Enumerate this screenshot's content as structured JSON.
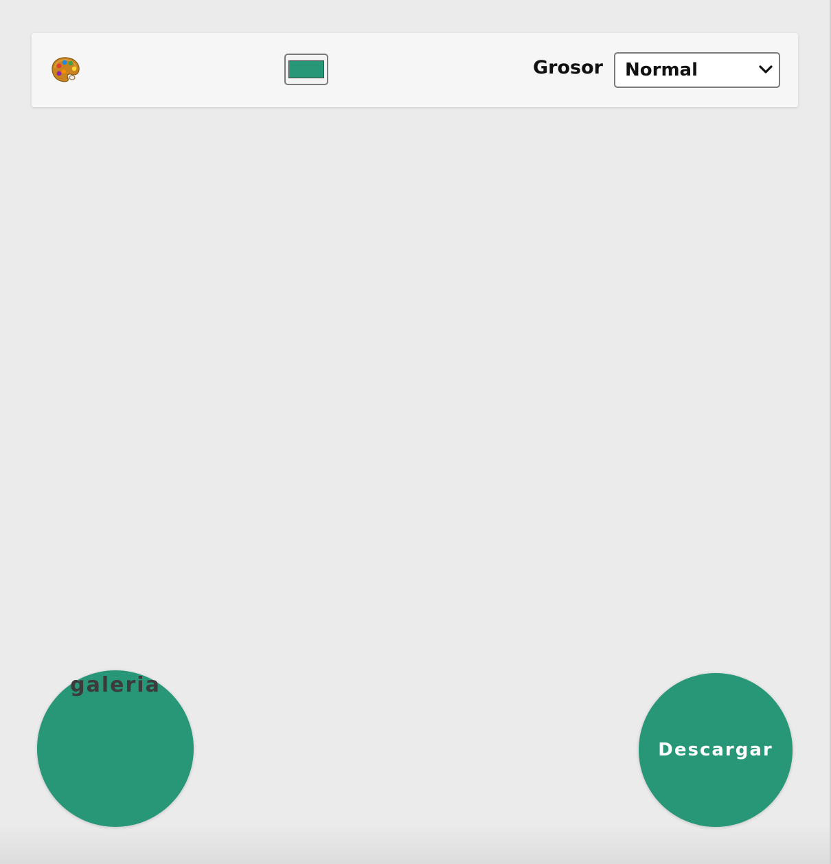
{
  "toolbar": {
    "palette_icon": "artist-palette-icon",
    "color_value": "#279777",
    "grosor_label": "Grosor",
    "grosor_selected": "Normal",
    "chevron_icon": "chevron-down-icon"
  },
  "buttons": {
    "galeria_label": "galeria",
    "descargar_label": "Descargar"
  },
  "colors": {
    "accent": "#279777",
    "background": "#ebebeb",
    "toolbar_bg": "#f6f6f6"
  }
}
